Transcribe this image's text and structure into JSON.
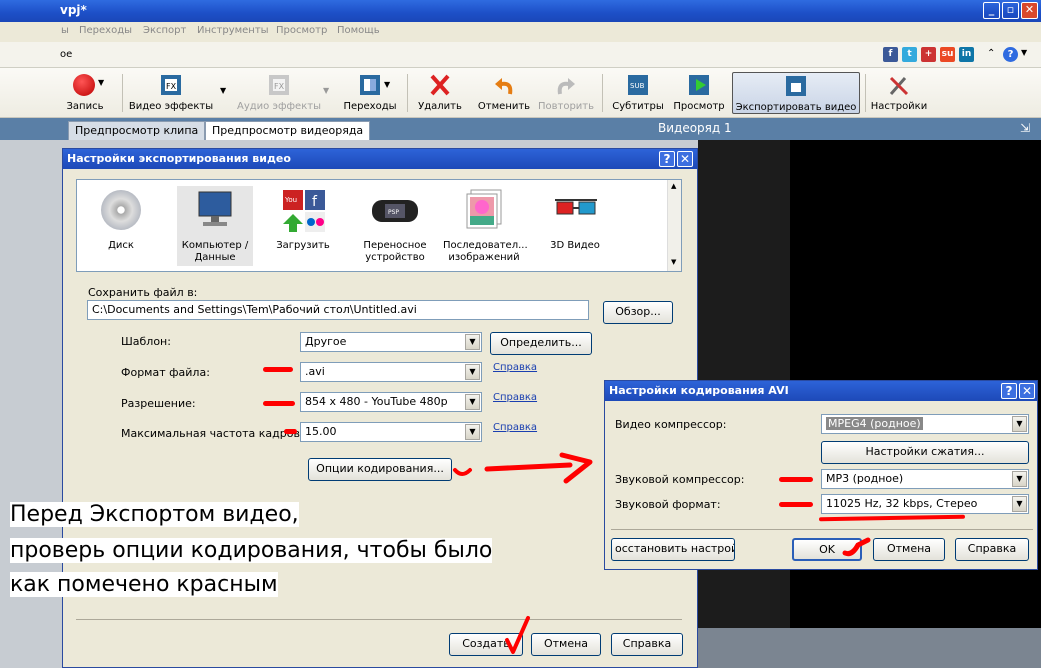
{
  "window": {
    "title": "vpj*"
  },
  "menu": [
    "ы",
    "Переходы",
    "Экспорт",
    "Инструменты",
    "Просмотр",
    "Помощь"
  ],
  "subbar_text": "ое",
  "social": [
    "f",
    "t",
    "+",
    "su",
    "in"
  ],
  "help_symbol": "?",
  "toolbar": {
    "record": "Запись",
    "video_effects": "Видео эффекты",
    "audio_effects": "Аудио эффекты",
    "transitions": "Переходы",
    "delete": "Удалить",
    "undo": "Отменить",
    "redo": "Повторить",
    "subtitles": "Субтитры",
    "preview": "Просмотр",
    "export_video": "Экспортировать видео",
    "settings": "Настройки"
  },
  "tabs": {
    "clip_preview": "Предпросмотр клипа",
    "sequence_preview": "Предпросмотр видеоряда",
    "sequence_label": "Видеоряд 1"
  },
  "export_dialog": {
    "title": "Настройки экспортирования видео",
    "devices": [
      {
        "label": "Диск"
      },
      {
        "label": "Компьютер / Данные"
      },
      {
        "label": "Загрузить"
      },
      {
        "label": "Переносное устройство"
      },
      {
        "label": "Последовател... изображений"
      },
      {
        "label": "3D Видео"
      }
    ],
    "save_to_label": "Сохранить файл в:",
    "save_path": "C:\\Documents and Settings\\Tem\\Рабочий стол\\Untitled.avi",
    "browse": "Обзор...",
    "template_label": "Шаблон:",
    "template_value": "Другое",
    "define": "Определить...",
    "format_label": "Формат файла:",
    "format_value": ".avi",
    "resolution_label": "Разрешение:",
    "resolution_value": "854 x 480 - YouTube 480p",
    "framerate_label": "Максимальная частота кадров:",
    "framerate_value": "15.00",
    "help_link": "Справка",
    "encoding_options": "Опции кодирования...",
    "create": "Создать",
    "cancel": "Отмена",
    "help": "Справка"
  },
  "avi_dialog": {
    "title": "Настройки кодирования AVI",
    "video_compressor_label": "Видео компрессор:",
    "video_compressor_value": "MPEG4 (родное)",
    "compression_settings": "Настройки сжатия...",
    "audio_compressor_label": "Звуковой компрессор:",
    "audio_compressor_value": "MP3 (родное)",
    "audio_format_label": "Звуковой формат:",
    "audio_format_value": "11025 Hz, 32 kbps, Стерео",
    "restore": "осстановить настройк",
    "ok": "OK",
    "cancel": "Отмена",
    "help": "Справка"
  },
  "annotation": {
    "line1": "Перед Экспортом видео,",
    "line2": "проверь опции кодирования, чтобы было",
    "line3": "как помечено красным"
  },
  "colors": {
    "accent_red": "#ff0000",
    "title_blue": "#1d4fc7"
  }
}
